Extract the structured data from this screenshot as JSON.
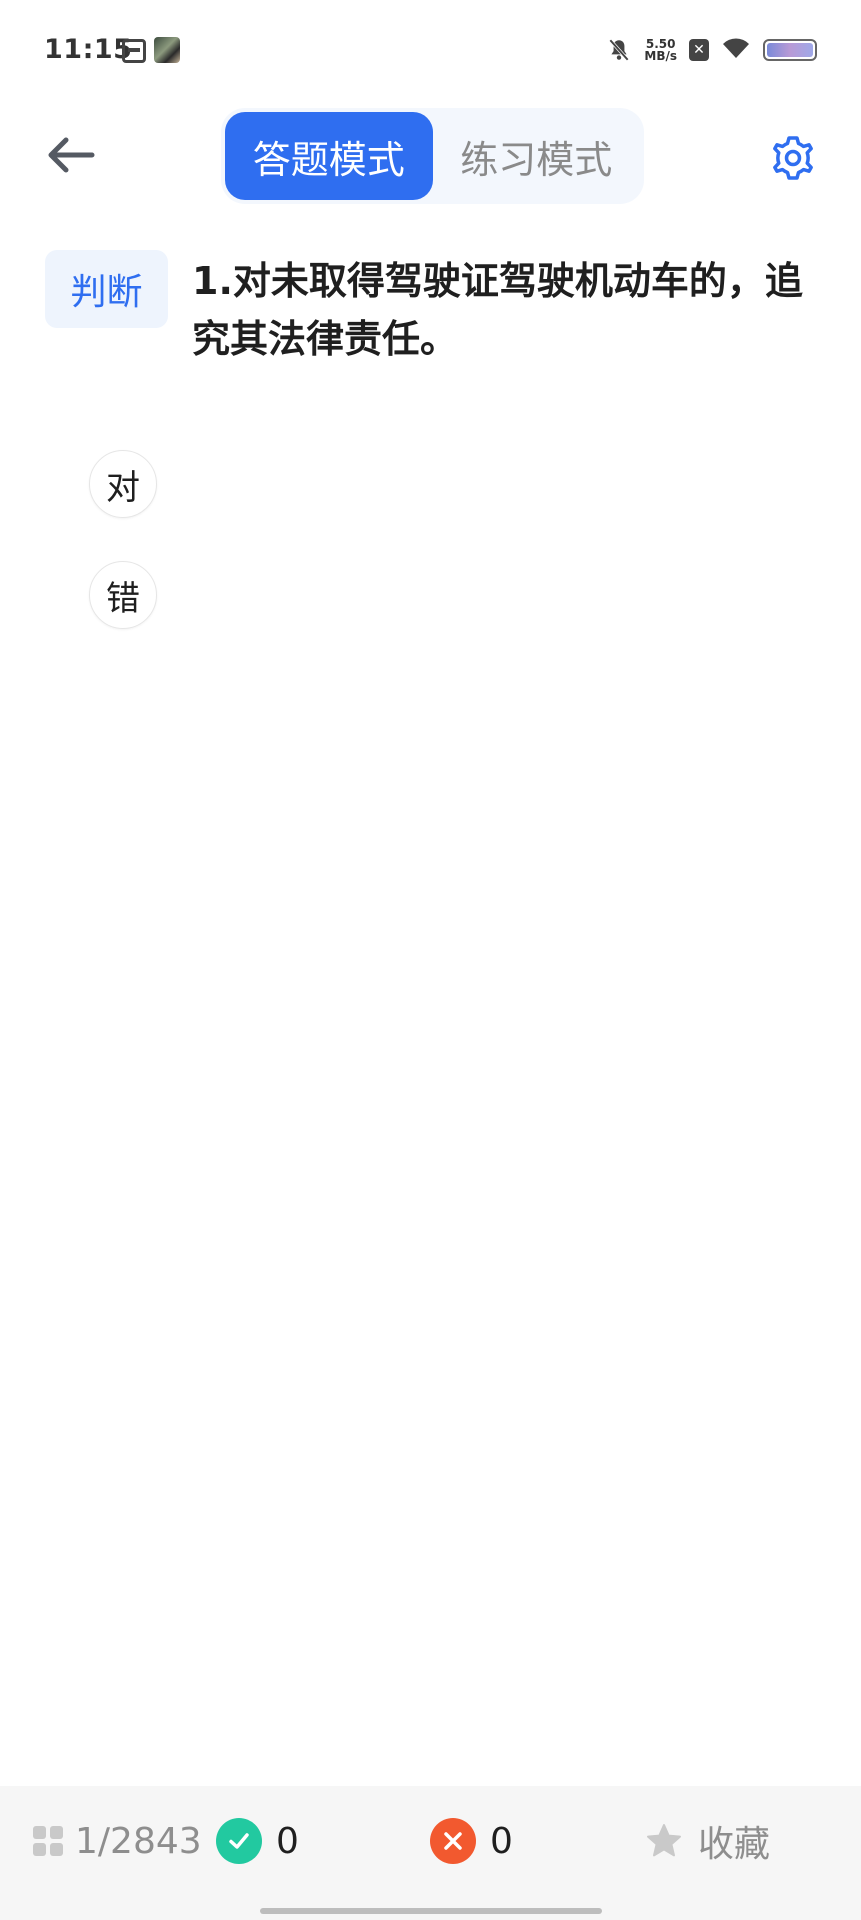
{
  "status_bar": {
    "time": "11:15",
    "net_speed_value": "5.50",
    "net_speed_unit": "MB/s"
  },
  "header": {
    "back_icon": "arrow-left-icon",
    "tabs": [
      {
        "label": "答题模式",
        "active": true
      },
      {
        "label": "练习模式",
        "active": false
      }
    ],
    "settings_icon": "gear-icon"
  },
  "question": {
    "type_tag": "判断",
    "text": "1.对未取得驾驶证驾驶机动车的，追究其法律责任。"
  },
  "options": [
    {
      "label": "对"
    },
    {
      "label": "错"
    }
  ],
  "bottom_bar": {
    "progress": "1/2843",
    "correct_count": "0",
    "wrong_count": "0",
    "favorite_label": "收藏"
  },
  "colors": {
    "accent": "#2f6ef0",
    "correct": "#22c9a0",
    "wrong": "#f2592f"
  }
}
